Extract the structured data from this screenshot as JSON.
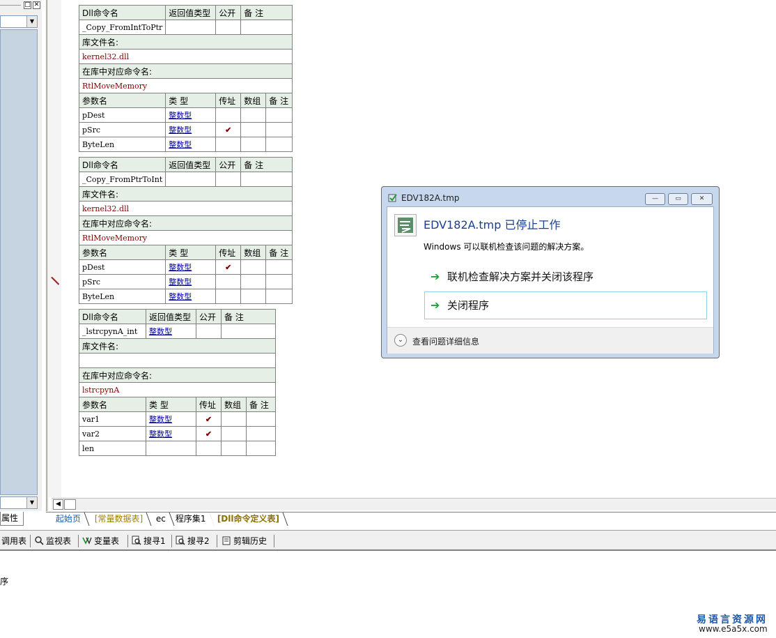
{
  "colors": {
    "header_bg": "#e6efe6",
    "lib_text": "#800000",
    "type_link": "#0000a0",
    "dialog_heading": "#1c3e8c",
    "dialog_arrow": "#1ea13a"
  },
  "left_panel": {
    "properties_tab": "属性"
  },
  "tables": [
    {
      "header": [
        "Dll命令名",
        "返回值类型",
        "公开",
        "备 注"
      ],
      "name": "_Copy_FromIntToPtr",
      "return_type": "",
      "lib_label": "库文件名:",
      "lib": "kernel32.dll",
      "entry_label": "在库中对应命令名:",
      "entry": "RtlMoveMemory",
      "param_header": [
        "参数名",
        "类 型",
        "传址",
        "数组",
        "备 注"
      ],
      "params": [
        {
          "name": "pDest",
          "type": "整数型",
          "byref": ""
        },
        {
          "name": "pSrc",
          "type": "整数型",
          "byref": "✔"
        },
        {
          "name": "ByteLen",
          "type": "整数型",
          "byref": ""
        }
      ]
    },
    {
      "header": [
        "Dll命令名",
        "返回值类型",
        "公开",
        "备 注"
      ],
      "name": "_Copy_FromPtrToInt",
      "return_type": "",
      "lib_label": "库文件名:",
      "lib": "kernel32.dll",
      "entry_label": "在库中对应命令名:",
      "entry": "RtlMoveMemory",
      "param_header": [
        "参数名",
        "类 型",
        "传址",
        "数组",
        "备 注"
      ],
      "params": [
        {
          "name": "pDest",
          "type": "整数型",
          "byref": "✔"
        },
        {
          "name": "pSrc",
          "type": "整数型",
          "byref": ""
        },
        {
          "name": "ByteLen",
          "type": "整数型",
          "byref": ""
        }
      ]
    },
    {
      "header": [
        "Dll命令名",
        "返回值类型",
        "公开",
        "备 注"
      ],
      "name": "_lstrcpynA_int",
      "return_type": "整数型",
      "lib_label": "库文件名:",
      "lib": "",
      "entry_label": "在库中对应命令名:",
      "entry": "lstrcpynA",
      "param_header": [
        "参数名",
        "类 型",
        "传址",
        "数组",
        "备 注"
      ],
      "params": [
        {
          "name": "var1",
          "type": "整数型",
          "byref": "✔"
        },
        {
          "name": "var2",
          "type": "整数型",
          "byref": "✔"
        },
        {
          "name": "len",
          "type": "",
          "byref": ""
        }
      ]
    }
  ],
  "file_tabs": [
    "起始页",
    "[常量数据表]",
    "ec",
    "程序集1",
    "[Dll命令定义表]"
  ],
  "toolbar": {
    "items": [
      "调用表",
      "监视表",
      "变量表",
      "搜寻1",
      "搜寻2",
      "剪辑历史"
    ]
  },
  "output": {
    "text": "序"
  },
  "dialog": {
    "title": "EDV182A.tmp",
    "heading": "EDV182A.tmp 已停止工作",
    "description": "Windows 可以联机检查该问题的解决方案。",
    "option1": "联机检查解决方案并关闭该程序",
    "option2": "关闭程序",
    "details": "查看问题详细信息"
  },
  "watermark": {
    "logo": "易语言资源网",
    "url": "www.e5a5x.com"
  }
}
